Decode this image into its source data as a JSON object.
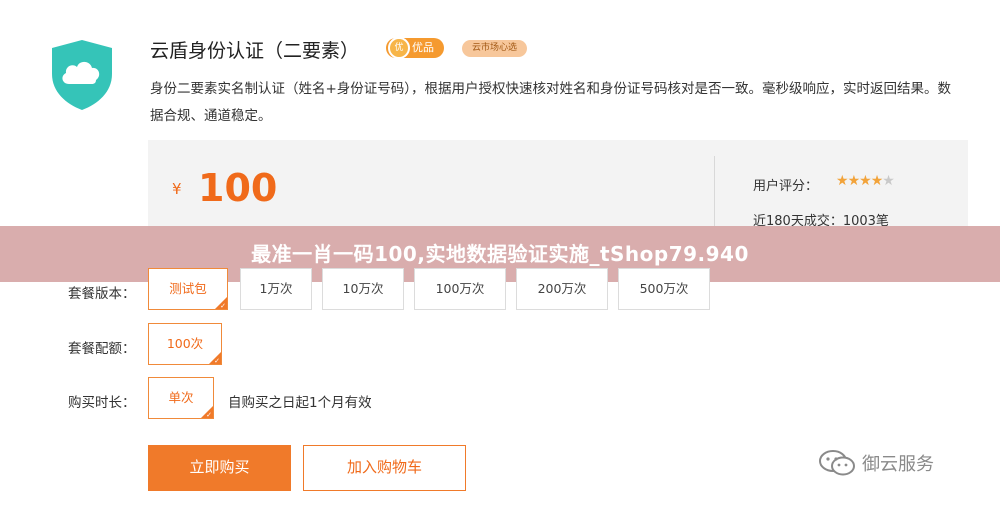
{
  "product": {
    "title": "云盾身份认证（二要素）",
    "badge_quality": "优品",
    "badge_quality_seal": "优",
    "badge_market": "云市场心选",
    "description": "身份二要素实名制认证（姓名+身份证号码），根据用户授权快速核对姓名和身份证号码核对是否一致。毫秒级响应，实时返回结果。数据合规、通道稳定。"
  },
  "price": {
    "currency": "¥",
    "amount": "100",
    "rating_label": "用户评分：",
    "rating": 4,
    "rating_max": 5,
    "deals": "近180天成交：1003笔"
  },
  "watermark": "最准一肖一码100,实地数据验证实施_tShop79.940",
  "options": {
    "version_label": "套餐版本：",
    "versions": [
      "测试包",
      "1万次",
      "10万次",
      "100万次",
      "200万次",
      "500万次"
    ],
    "selected_version": "测试包",
    "quota_label": "套餐配额：",
    "quota": "100次",
    "duration_label": "购买时长：",
    "duration": "单次",
    "validity": "自购买之日起1个月有效"
  },
  "actions": {
    "buy": "立即购买",
    "cart": "加入购物车"
  },
  "wechat_watermark": "御云服务",
  "colors": {
    "accent": "#f07a2a",
    "logo": "#35c4b8",
    "watermark_band": "#d6a6a6"
  }
}
